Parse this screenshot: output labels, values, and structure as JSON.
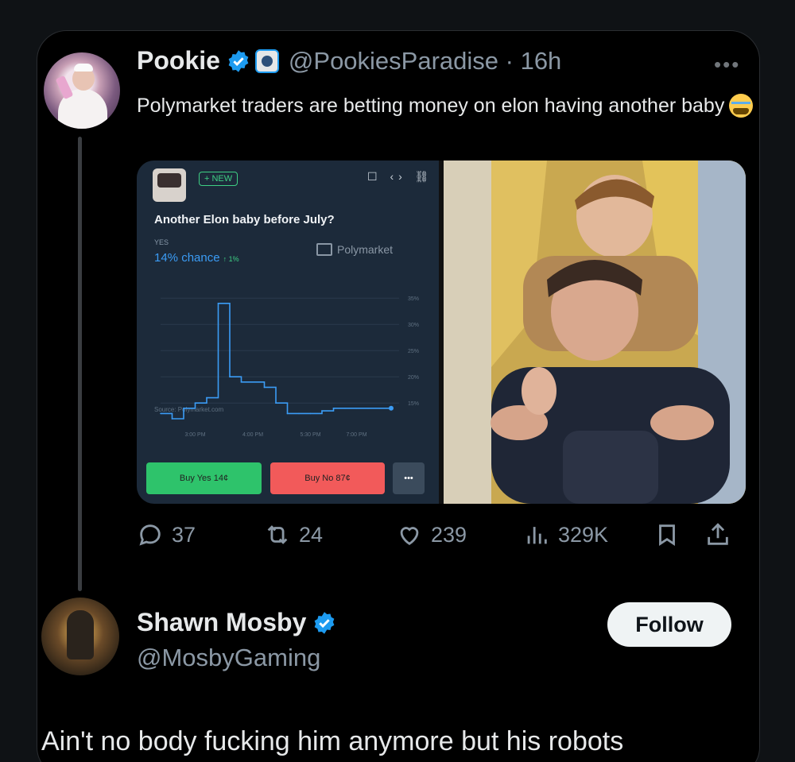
{
  "tweet": {
    "author_name": "Pookie",
    "handle_time": "@PookiesParadise · 16h",
    "text": "Polymarket traders are betting money on elon having another baby",
    "more_label": "•••",
    "emoji": "loudly-crying-face-icon"
  },
  "polymarket": {
    "new_badge": "+ NEW",
    "title": "Another Elon baby before July?",
    "outcome_label": "YES",
    "chance": "14% chance",
    "change": "↑ 1%",
    "brand": "Polymarket",
    "source": "Source: Polymarket.com",
    "buy_yes": "Buy Yes 14¢",
    "buy_no": "Buy No 87¢",
    "more": "•••",
    "y_ticks": [
      "35%",
      "30%",
      "25%",
      "20%",
      "15%"
    ],
    "x_ticks": [
      "3:00 PM",
      "4:00 PM",
      "5:30 PM",
      "7:00 PM"
    ]
  },
  "chart_data": {
    "type": "line",
    "title": "Another Elon baby before July?",
    "xlabel": "",
    "ylabel": "",
    "x": [
      0,
      1,
      2,
      3,
      4,
      5,
      6,
      7,
      8,
      9,
      10,
      11,
      12,
      13,
      14,
      15,
      16,
      17,
      18,
      19,
      20
    ],
    "series": [
      {
        "name": "YES",
        "values": [
          13,
          12,
          14,
          15,
          16,
          34,
          20,
          19,
          19,
          18,
          15,
          13,
          13,
          13,
          13.5,
          14,
          14,
          14,
          14,
          14,
          14
        ]
      }
    ],
    "ylim": [
      12,
      37
    ],
    "x_tick_labels": [
      "3:00 PM",
      "4:00 PM",
      "5:30 PM",
      "7:00 PM"
    ],
    "y_tick_labels": [
      "35%",
      "30%",
      "25%",
      "20%",
      "15%"
    ]
  },
  "actions": {
    "replies": "37",
    "reposts": "24",
    "likes": "239",
    "views": "329K"
  },
  "reply": {
    "author_name": "Shawn Mosby",
    "handle": "@MosbyGaming",
    "follow_label": "Follow",
    "text": "Ain't no body fucking him anymore but his robots"
  },
  "colors": {
    "background": "#000000",
    "verified_blue": "#1d9bf0",
    "muted_text": "#8b98a5",
    "buy_yes": "#2ec36b",
    "buy_no": "#f25a5a"
  }
}
